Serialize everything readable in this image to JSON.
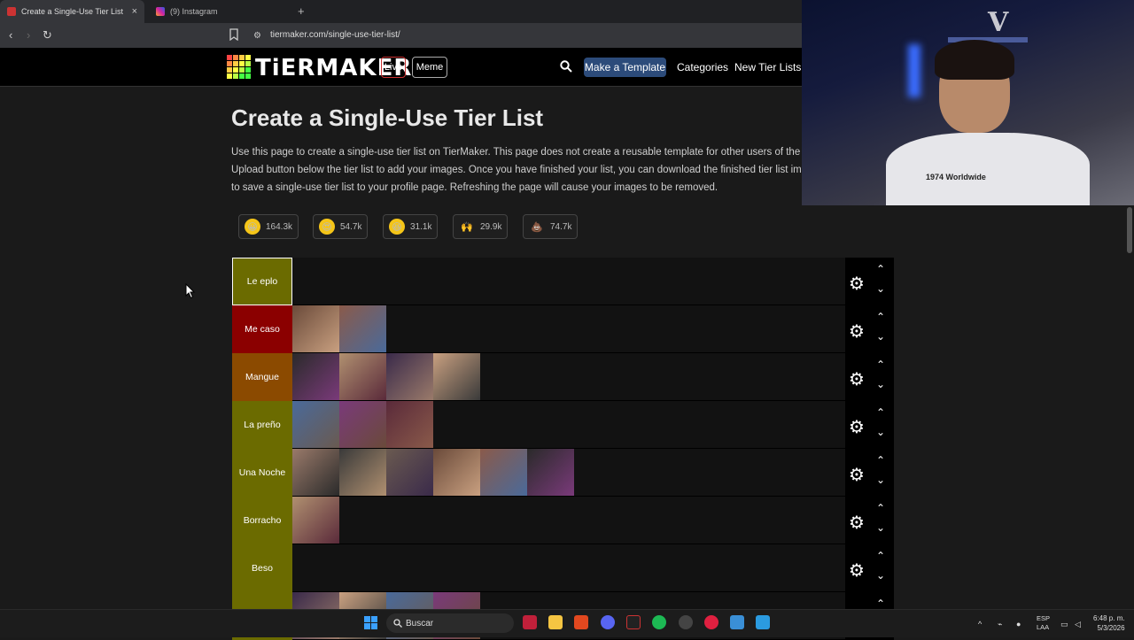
{
  "browser": {
    "tabs": [
      {
        "title": "Create a Single-Use Tier List (Pr",
        "active": true
      },
      {
        "title": "(9) Instagram",
        "active": false
      }
    ],
    "new_tab": "+",
    "url": "tiermaker.com/single-use-tier-list/"
  },
  "site": {
    "logo": "TiERMAKER",
    "nav": {
      "live": "Live",
      "meme": "Meme",
      "make_template": "Make a Template",
      "categories": "Categories",
      "new_tier_lists": "New Tier Lists"
    }
  },
  "page": {
    "title": "Create a Single-Use Tier List",
    "description": [
      "Use this page to create a single-use tier list on TierMaker. This page does not create a reusable template for other users of the w",
      "Upload button below the tier list to add your images. Once you have finished your list, you can download the finished tier list imag",
      "to save a single-use tier list to your profile page. Refreshing the page will cause your images to be removed."
    ]
  },
  "reactions": [
    {
      "emoji": "grin",
      "count": "164.3k"
    },
    {
      "emoji": "heart-eyes",
      "count": "54.7k"
    },
    {
      "emoji": "laughing",
      "count": "31.1k"
    },
    {
      "emoji": "raised-hands",
      "count": "29.9k"
    },
    {
      "emoji": "poop",
      "count": "74.7k"
    }
  ],
  "tiers": [
    {
      "label": "Le eplo",
      "color": "#6b6b00",
      "items": 0
    },
    {
      "label": "Me caso",
      "color": "#8b0000",
      "items": 2
    },
    {
      "label": "Mangue",
      "color": "#8b4a00",
      "items": 4
    },
    {
      "label": "La preño",
      "color": "#6b6b00",
      "items": 3
    },
    {
      "label": "Una Noche",
      "color": "#6b6b00",
      "items": 6
    },
    {
      "label": "Borracho",
      "color": "#6b6b00",
      "items": 1
    },
    {
      "label": "Beso",
      "color": "#6b6b00",
      "items": 0
    },
    {
      "label": "",
      "color": "#6b6b00",
      "items": 4
    }
  ],
  "taskbar": {
    "search": "Buscar",
    "lang": "ESP",
    "lang2": "LAA",
    "time": "6:48 p. m.",
    "date": "5/3/2026"
  },
  "webcam": {
    "shirt_text": "1974 Worldwide"
  }
}
